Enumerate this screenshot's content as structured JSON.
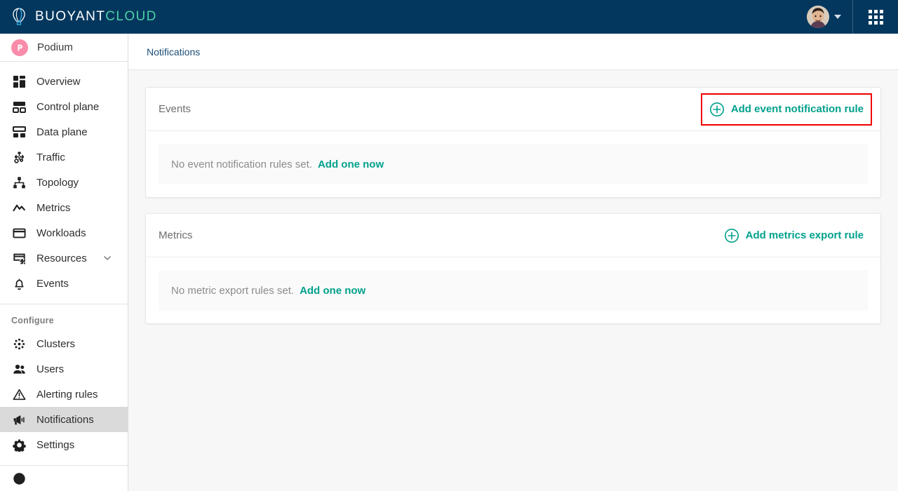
{
  "topbar": {
    "brand_primary": "BUOYANT",
    "brand_secondary": "CLOUD",
    "brand_icon": "hot-air-balloon-icon",
    "avatar_name": "user-avatar",
    "user_menu_icon": "chevron-down-icon",
    "apps_icon": "apps-grid-icon",
    "bg_color": "#04375e",
    "accent_color": "#4fd0a6"
  },
  "sidebar": {
    "org": {
      "name": "Podium",
      "logo_icon": "podium-logo-icon",
      "logo_color": "#f98ca8"
    },
    "items": [
      {
        "label": "Overview",
        "icon": "dashboard-icon",
        "active": false
      },
      {
        "label": "Control plane",
        "icon": "control-plane-icon",
        "active": false
      },
      {
        "label": "Data plane",
        "icon": "data-plane-icon",
        "active": false
      },
      {
        "label": "Traffic",
        "icon": "traffic-icon",
        "active": false
      },
      {
        "label": "Topology",
        "icon": "topology-icon",
        "active": false
      },
      {
        "label": "Metrics",
        "icon": "metrics-chart-icon",
        "active": false
      },
      {
        "label": "Workloads",
        "icon": "workloads-icon",
        "active": false
      },
      {
        "label": "Resources",
        "icon": "resources-icon",
        "active": false,
        "caret": "chevron-down-icon"
      },
      {
        "label": "Events",
        "icon": "bell-icon",
        "active": false
      }
    ],
    "configure_heading": "Configure",
    "configure_items": [
      {
        "label": "Clusters",
        "icon": "clusters-icon",
        "active": false
      },
      {
        "label": "Users",
        "icon": "users-icon",
        "active": false
      },
      {
        "label": "Alerting rules",
        "icon": "warning-triangle-icon",
        "active": false
      },
      {
        "label": "Notifications",
        "icon": "megaphone-icon",
        "active": true
      },
      {
        "label": "Settings",
        "icon": "gear-icon",
        "active": false
      }
    ]
  },
  "breadcrumb": {
    "current": "Notifications"
  },
  "main": {
    "cards": [
      {
        "title": "Events",
        "action_label": "Add event notification rule",
        "action_icon": "plus-circle-icon",
        "action_highlighted": true,
        "empty_text": "No event notification rules set.",
        "empty_link": "Add one now"
      },
      {
        "title": "Metrics",
        "action_label": "Add metrics export rule",
        "action_icon": "plus-circle-icon",
        "action_highlighted": false,
        "empty_text": "No metric export rules set.",
        "empty_link": "Add one now"
      }
    ]
  },
  "colors": {
    "teal_link": "#00a18c",
    "annotation_red": "#ee0000",
    "header_navy": "#04375e",
    "page_bg": "#f7f7f7"
  }
}
